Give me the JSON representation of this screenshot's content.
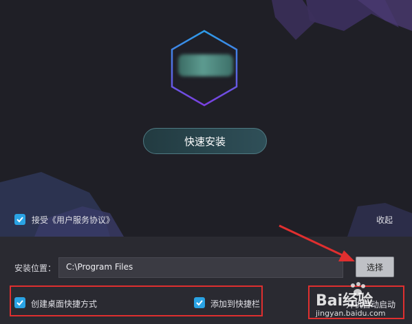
{
  "installer": {
    "install_button_label": "快速安装",
    "agreement": {
      "label": "接受《用户服务协议》",
      "checked": true
    },
    "collapse_label": "收起",
    "install_path": {
      "label": "安装位置：",
      "value": "C:\\Program Files"
    },
    "choose_button_label": "选择",
    "options": [
      {
        "label": "创建桌面快捷方式",
        "checked": true
      },
      {
        "label": "添加到快捷栏",
        "checked": true
      },
      {
        "label": "开机自动启动",
        "checked": false
      }
    ]
  },
  "watermark": {
    "brand": "Bai经验",
    "url": "jingyan.baidu.com"
  },
  "colors": {
    "accent": "#2aa3e4",
    "highlight": "#e02f2f",
    "background": "#222228"
  }
}
